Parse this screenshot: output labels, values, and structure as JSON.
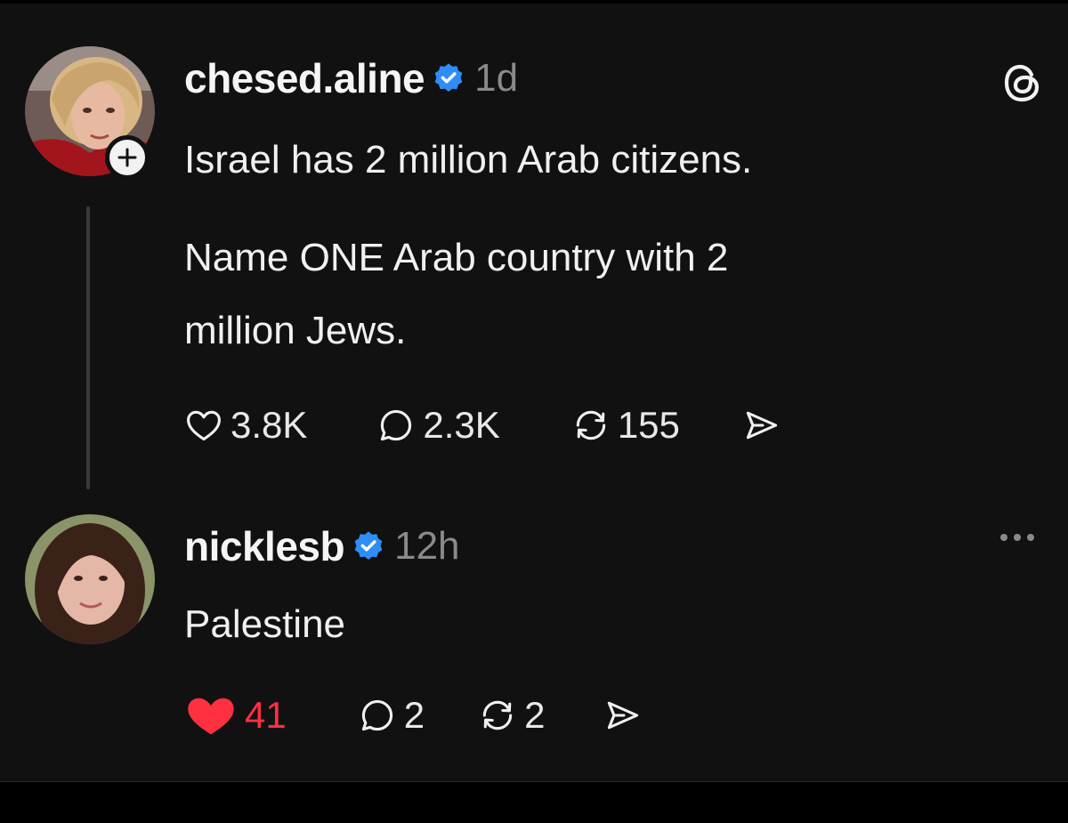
{
  "post": {
    "username": "chesed.aline",
    "timestamp": "1d",
    "lines": [
      "Israel has 2 million Arab citizens.",
      "Name ONE Arab country with 2",
      "million Jews."
    ],
    "likes": "3.8K",
    "replies": "2.3K",
    "reposts": "155"
  },
  "reply": {
    "username": "nicklesb",
    "timestamp": "12h",
    "text": "Palestine",
    "likes": "41",
    "replies": "2",
    "reposts": "2"
  },
  "colors": {
    "background": "#111112",
    "verified": "#2f8ef5",
    "liked": "#ff3040",
    "muted": "#8a8a8a"
  },
  "icons": [
    "heart-icon",
    "comment-icon",
    "repost-icon",
    "share-icon",
    "threads-logo-icon",
    "verified-badge-icon",
    "plus-icon",
    "more-icon"
  ]
}
